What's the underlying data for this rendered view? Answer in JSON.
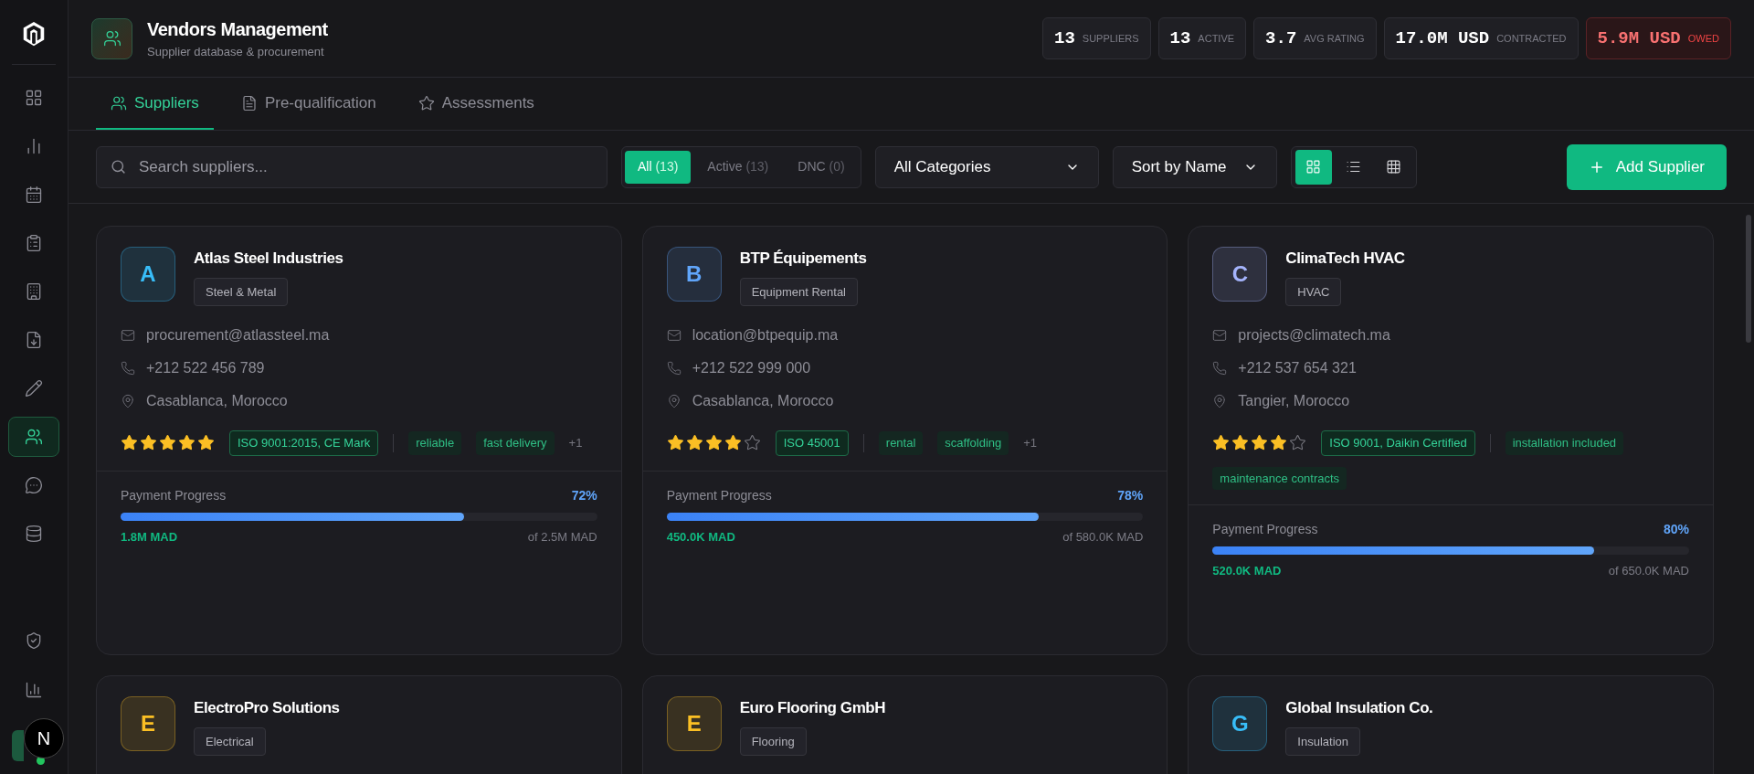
{
  "sidebar": {
    "items": [
      {
        "selected": false
      },
      {
        "selected": false
      },
      {
        "selected": false
      },
      {
        "selected": false
      },
      {
        "selected": false
      },
      {
        "selected": false
      },
      {
        "selected": false
      },
      {
        "selected": true
      },
      {
        "selected": false
      },
      {
        "selected": false
      }
    ],
    "bottom_items": [
      {
        "selected": false
      },
      {
        "selected": false
      }
    ],
    "dev_badge": "N"
  },
  "header": {
    "title": "Vendors Management",
    "subtitle": "Supplier database & procurement",
    "stats": [
      {
        "value": "13",
        "label": "SUPPLIERS",
        "kind": "normal"
      },
      {
        "value": "13",
        "label": "ACTIVE",
        "kind": "normal"
      },
      {
        "value": "3.7",
        "label": "AVG RATING",
        "kind": "normal"
      },
      {
        "value": "17.0M USD",
        "label": "CONTRACTED",
        "kind": "normal"
      },
      {
        "value": "5.9M USD",
        "label": "OWED",
        "kind": "alert"
      }
    ]
  },
  "tabs": [
    {
      "label": "Suppliers",
      "selected": true
    },
    {
      "label": "Pre-qualification",
      "selected": false
    },
    {
      "label": "Assessments",
      "selected": false
    }
  ],
  "toolbar": {
    "search": {
      "placeholder": "Search suppliers..."
    },
    "filters": [
      {
        "label": "All",
        "count": "(13)",
        "selected": true
      },
      {
        "label": "Active",
        "count": "(13)",
        "selected": false
      },
      {
        "label": "DNC",
        "count": "(0)",
        "selected": false
      }
    ],
    "category": "All Categories",
    "sort": "Sort by Name",
    "views": [
      {
        "selected": true
      },
      {
        "selected": false
      },
      {
        "selected": false
      }
    ],
    "add_button": "Add Supplier"
  },
  "suppliers": [
    {
      "initial": "A",
      "color": "#38bdf8",
      "name": "Atlas Steel Industries",
      "category": "Steel & Metal",
      "email": "procurement@atlassteel.ma",
      "phone": "+212 522 456 789",
      "location": "Casablanca, Morocco",
      "stars": 5,
      "certification": "ISO 9001:2015, CE Mark",
      "tags": [
        "reliable",
        "fast delivery"
      ],
      "more": "+1",
      "payment": {
        "label": "Payment Progress",
        "percent": "72%",
        "level": 0.72,
        "paid": "1.8M MAD",
        "total": "of 2.5M MAD"
      }
    },
    {
      "initial": "B",
      "color": "#60a5fa",
      "name": "BTP Équipements",
      "category": "Equipment Rental",
      "email": "location@btpequip.ma",
      "phone": "+212 522 999 000",
      "location": "Casablanca, Morocco",
      "stars": 4,
      "certification": "ISO 45001",
      "tags": [
        "rental",
        "scaffolding"
      ],
      "more": "+1",
      "payment": {
        "label": "Payment Progress",
        "percent": "78%",
        "level": 0.78,
        "paid": "450.0K MAD",
        "total": "of 580.0K MAD"
      }
    },
    {
      "initial": "C",
      "color": "#a5b4fc",
      "name": "ClimaTech HVAC",
      "category": "HVAC",
      "email": "projects@climatech.ma",
      "phone": "+212 537 654 321",
      "location": "Tangier, Morocco",
      "stars": 4,
      "certification": "ISO 9001, Daikin Certified",
      "tags": [
        "installation included",
        "maintenance contracts"
      ],
      "payment": {
        "label": "Payment Progress",
        "percent": "80%",
        "level": 0.8,
        "paid": "520.0K MAD",
        "total": "of 650.0K MAD"
      }
    },
    {
      "initial": "E",
      "color": "#fbbf24",
      "name": "ElectroPro Solutions",
      "category": "Electrical"
    },
    {
      "initial": "E",
      "color": "#fbbf24",
      "name": "Euro Flooring GmbH",
      "category": "Flooring"
    },
    {
      "initial": "G",
      "color": "#38bdf8",
      "name": "Global Insulation Co.",
      "category": "Insulation"
    }
  ]
}
